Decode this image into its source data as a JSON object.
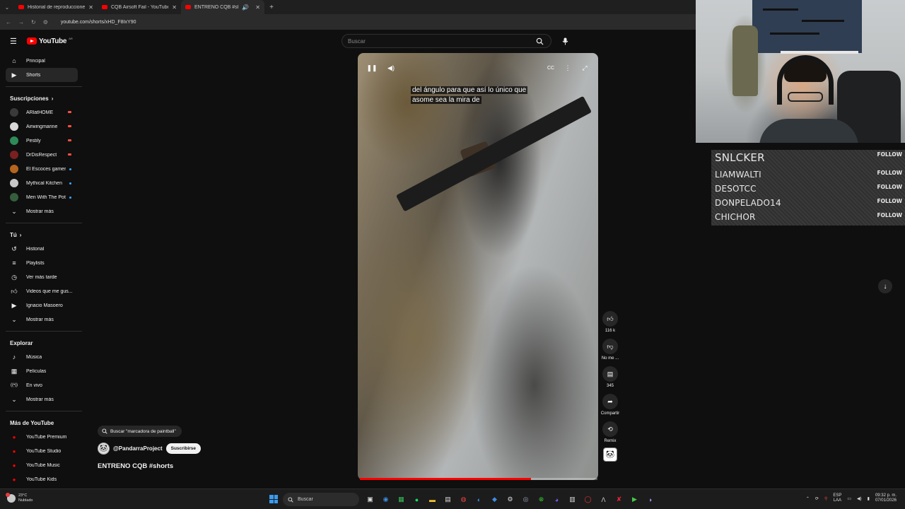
{
  "browser": {
    "tabs": [
      {
        "title": "Historial de reproducciones - Yo",
        "active": false
      },
      {
        "title": "CQB Airsoft Fail - YouTube",
        "active": false
      },
      {
        "title": "ENTRENO CQB #shorts - Yo",
        "active": true
      }
    ],
    "url": "youtube.com/shorts/xHD_F8IxY90"
  },
  "header": {
    "logo_text": "YouTube",
    "logo_region": "AR",
    "search_placeholder": "Buscar"
  },
  "sidebar": {
    "top": [
      {
        "label": "Principal",
        "icon": "home-icon"
      },
      {
        "label": "Shorts",
        "icon": "shorts-icon",
        "selected": true
      }
    ],
    "subs_heading": "Suscripciones",
    "subscriptions": [
      {
        "label": "ARlatHOME",
        "avatar_color": "#3a3a3a",
        "status": "live"
      },
      {
        "label": "Airwingmarine",
        "avatar_color": "#d8d8d8",
        "status": "live"
      },
      {
        "label": "Pestily",
        "avatar_color": "#2e8b57",
        "status": "live"
      },
      {
        "label": "DrDisRespect",
        "avatar_color": "#7a2020",
        "status": "live"
      },
      {
        "label": "El Escoces gamer",
        "avatar_color": "#b5651d",
        "status": "new"
      },
      {
        "label": "Mythical Kitchen",
        "avatar_color": "#c8c8c8",
        "status": "new"
      },
      {
        "label": "Men With The Pot",
        "avatar_color": "#355e3b",
        "status": "new"
      }
    ],
    "subs_more": "Mostrar más",
    "you_heading": "Tú",
    "you_items": [
      {
        "label": "Historial",
        "icon": "history-icon"
      },
      {
        "label": "Playlists",
        "icon": "playlist-icon"
      },
      {
        "label": "Ver más tarde",
        "icon": "clock-icon"
      },
      {
        "label": "Videos que me gus...",
        "icon": "like-icon"
      },
      {
        "label": "Ignacio Masoero",
        "icon": "your-videos-icon"
      }
    ],
    "you_more": "Mostrar más",
    "explore_heading": "Explorar",
    "explore_items": [
      {
        "label": "Música",
        "icon": "music-icon"
      },
      {
        "label": "Películas",
        "icon": "movies-icon"
      },
      {
        "label": "En vivo",
        "icon": "live-icon"
      }
    ],
    "explore_more": "Mostrar más",
    "more_heading": "Más de YouTube",
    "more_items": [
      {
        "label": "YouTube Premium"
      },
      {
        "label": "YouTube Studio"
      },
      {
        "label": "YouTube Music"
      },
      {
        "label": "YouTube Kids"
      }
    ]
  },
  "short": {
    "caption_line1": "del ángulo para que así lo único que",
    "caption_line2": "asome sea la mira de",
    "progress_fraction": 0.72,
    "suggestion": "Buscar \"marcadora de paintball\"",
    "channel": "@PandarraProject",
    "subscribe": "Suscribirse",
    "title": "ENTRENO CQB #shorts",
    "actions": {
      "likes": "116 k",
      "dislike": "No me ...",
      "comments": "345",
      "share": "Compartir",
      "remix": "Remix"
    }
  },
  "overlay": {
    "followers": [
      {
        "name": "SNLCKER",
        "button": "FOLLOW"
      },
      {
        "name": "LIAMWALTI",
        "button": "FOLLOW"
      },
      {
        "name": "DESOTCC",
        "button": "FOLLOW"
      },
      {
        "name": "DONPELADO14",
        "button": "FOLLOW"
      },
      {
        "name": "CHICHOR",
        "button": "FOLLOW"
      }
    ]
  },
  "taskbar": {
    "temp": "23°C",
    "weather": "Nublado",
    "search": "Buscar",
    "lang1": "ESP",
    "lang2": "LAA",
    "time": "09:32 p. m.",
    "date": "07/01/2026"
  }
}
